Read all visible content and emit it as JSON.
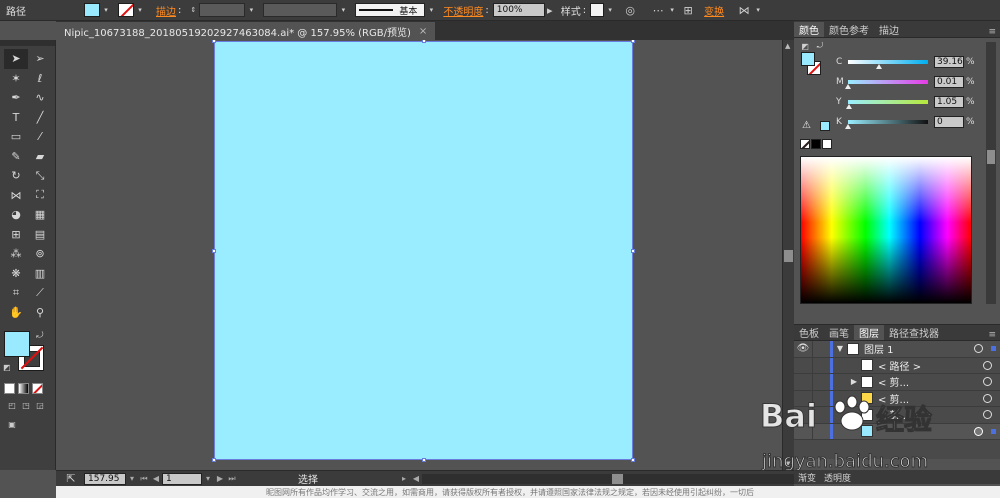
{
  "colors": {
    "fill": "#99eafe",
    "artboard": "#99edfe",
    "accent": "#4d70e0",
    "orange_link": "#ff8a1f"
  },
  "control_bar": {
    "path_label": "路径",
    "stroke_label": "描边",
    "stroke_style_label": "基本",
    "opacity_label": "不透明度",
    "opacity_value": "100%",
    "style_label": "样式",
    "transform_label": "变换"
  },
  "document_tab": {
    "title": "Nipic_10673188_20180519202927463084.ai* @ 157.95% (RGB/预览)",
    "close": "×"
  },
  "status_bar": {
    "zoom": "157.95",
    "artboard_number": "1",
    "current_tool": "选择"
  },
  "color_panel": {
    "tabs": [
      "颜色",
      "颜色参考",
      "描边"
    ],
    "channels": [
      {
        "name": "C",
        "value": "39.16",
        "level": 0.3916
      },
      {
        "name": "M",
        "value": "0.01",
        "level": 0.0001
      },
      {
        "name": "Y",
        "value": "1.05",
        "level": 0.0105
      },
      {
        "name": "K",
        "value": "0",
        "level": 0
      }
    ],
    "percent": "%"
  },
  "layers_panel": {
    "tabs": [
      "色板",
      "画笔",
      "图层",
      "路径查找器"
    ],
    "rows": [
      {
        "name": "图层 1",
        "expanded": true
      },
      {
        "name": "< 路径 >"
      },
      {
        "name": "< 剪..."
      },
      {
        "name": "< 剪..."
      },
      {
        "name": "< 剪..."
      }
    ],
    "footer_tabs": [
      "渐变",
      "透明度"
    ]
  },
  "bottom_strip_text": "昵图网所有作品均作学习、交流之用，如需商用，请获得版权所有者授权，并请遵照国家法律法规之规定，若因未经使用引起纠纷，一切后"
}
